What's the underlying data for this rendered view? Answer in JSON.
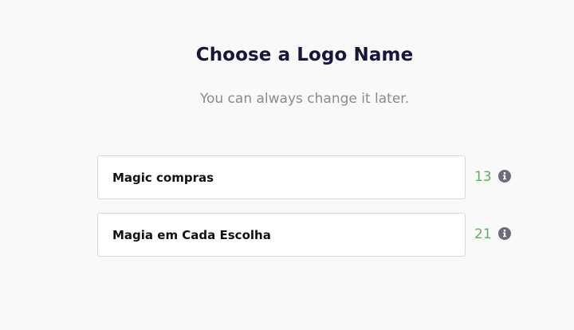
{
  "header": {
    "title": "Choose a Logo Name",
    "subtitle": "You can always change it later."
  },
  "fields": [
    {
      "value": "Magic compras",
      "count": "13",
      "icon": "info-icon"
    },
    {
      "value": "Magia em Cada Escolha",
      "count": "21",
      "icon": "info-icon"
    }
  ],
  "colors": {
    "title": "#14163c",
    "subtitle": "#8a8a8a",
    "count": "#5bb35b",
    "icon": "#6b6b7b",
    "background": "#f9f9f9"
  }
}
